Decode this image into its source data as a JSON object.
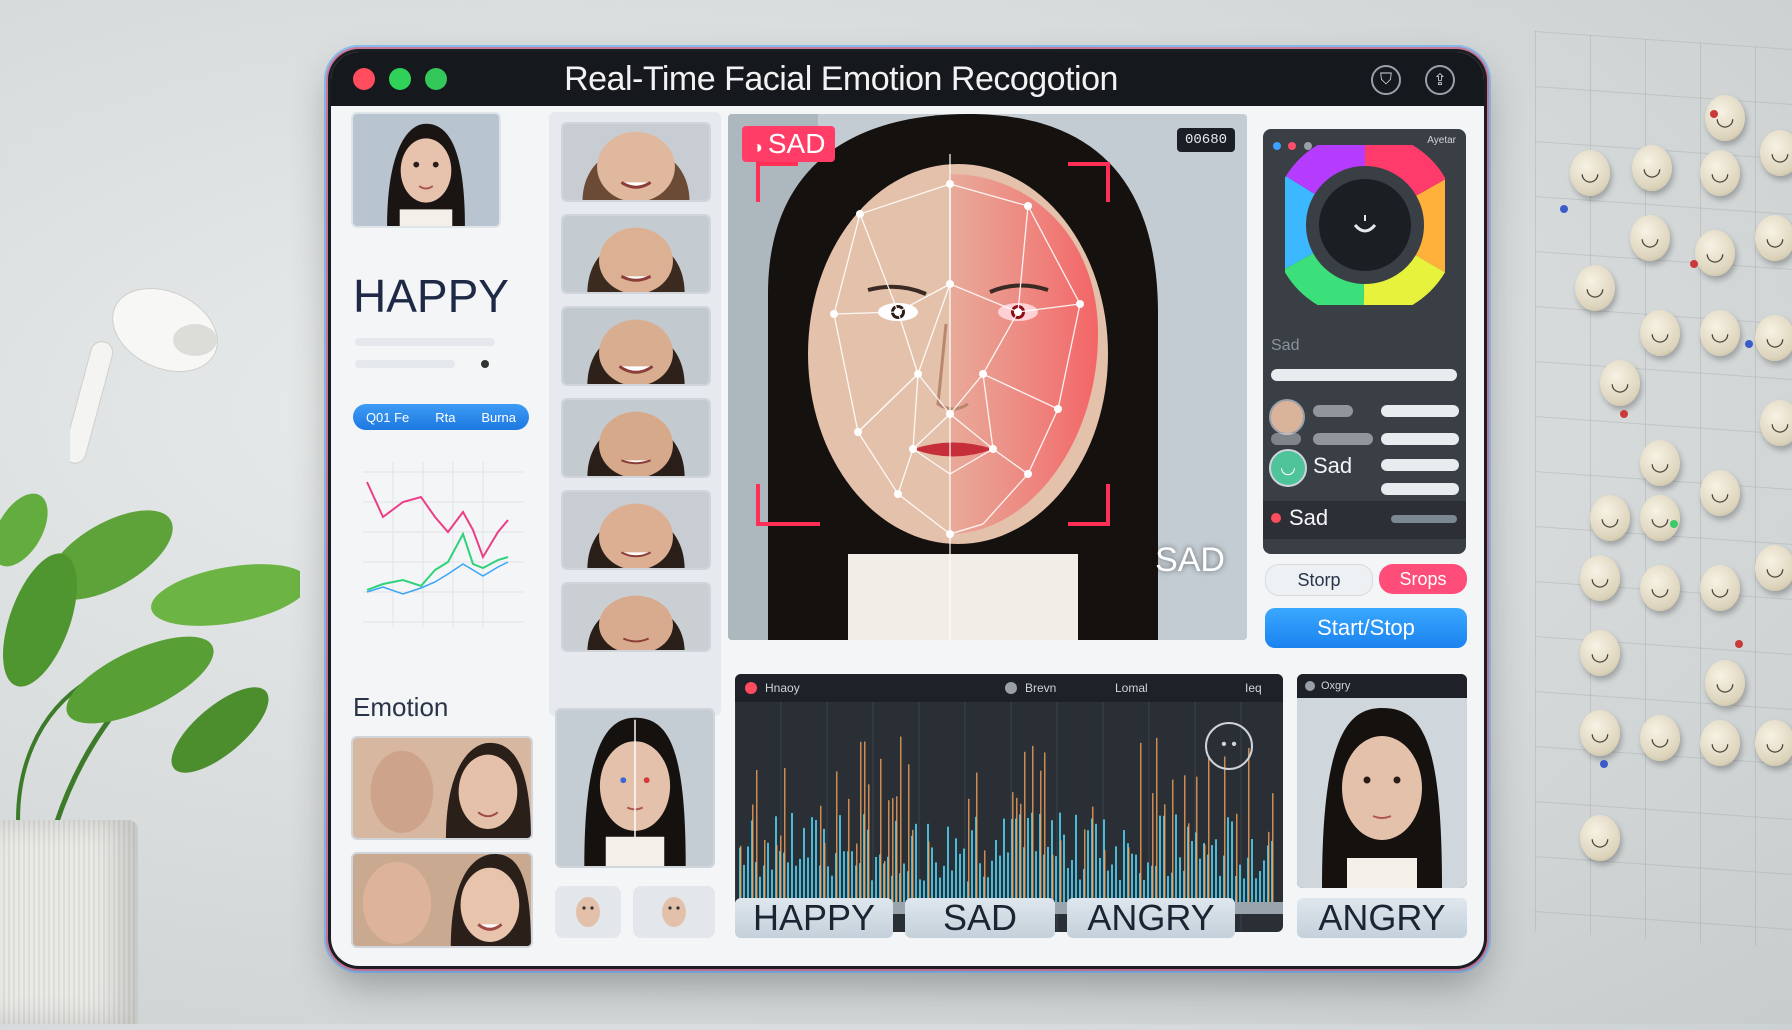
{
  "window": {
    "title": "Real-Time Facial Emotion Recogotion",
    "controls": {
      "close_color": "#ff4d5e",
      "min_color": "#30d158",
      "max_color": "#34c759"
    }
  },
  "left_column": {
    "emotion_result": "HAPPY",
    "button_labels": [
      "Q01 Fe",
      "Rta",
      "Burna"
    ],
    "section_label": "Emotion"
  },
  "main_viewer": {
    "tag": "SAD",
    "counter": "00680",
    "result_label": "SAD"
  },
  "right_panel": {
    "header_label": "Ayetar",
    "list_items": [
      {
        "label": "Sad"
      },
      {
        "label": "Sad"
      }
    ],
    "faded_label": "Sad",
    "stop_button": "Storp",
    "stop_pink_button": "Srops",
    "start_stop_button": "Start/Stop"
  },
  "waveform": {
    "header_left": "Hnaoy",
    "header_mid": "Brevn",
    "header_right": "Lomal",
    "header_far": "Ieq",
    "colors": {
      "bars": "#4fd3f5",
      "spikes": "#f5a25b"
    }
  },
  "bottom_right": {
    "header": "Oxgry"
  },
  "emotion_buttons": [
    "HAPPY",
    "SAD",
    "ANGRY",
    "ANGRY"
  ],
  "icons": [
    "traffic-lights",
    "shield-icon",
    "share-icon",
    "face-icon",
    "smile-icon"
  ]
}
